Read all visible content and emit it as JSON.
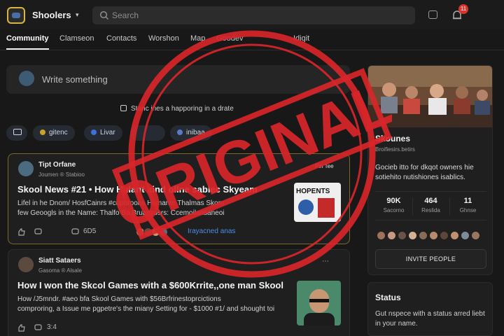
{
  "app": {
    "title": "Shoolers"
  },
  "search": {
    "placeholder": "Search"
  },
  "notifications": {
    "badge": "11"
  },
  "nav": {
    "tabs": [
      {
        "label": "Community",
        "active": true
      },
      {
        "label": "Clamseon"
      },
      {
        "label": "Contacts"
      },
      {
        "label": "Worshon"
      },
      {
        "label": "Map"
      },
      {
        "label": "Goodev"
      },
      {
        "label": "Idigit"
      }
    ]
  },
  "composer": {
    "placeholder": "Write something"
  },
  "happening": {
    "text": "Stanc ines a happoring in a drate"
  },
  "filters": [
    {
      "label": "",
      "color": ""
    },
    {
      "label": "gitenc",
      "color": "#c9a227"
    },
    {
      "label": "Livar",
      "color": "#3a72d6"
    },
    {
      "label": "",
      "color": ""
    },
    {
      "label": "inibaa",
      "color": "#5b79c9"
    }
  ],
  "posts": [
    {
      "author": "Tipt Orfane",
      "meta": "Joumen ® Stabioo",
      "pin_label": "Pin Tee",
      "title": "Skool News #21 • How Hulant kind ollne sablec Skyeam",
      "body": [
        "Lifel in he Dnom/ HosfCainrs #cupbroons Homante Thalmas Skom",
        "few Geoogls in the Name: Thalfo Ba Bruarrrosrs: Ccemoilansaneoi"
      ],
      "thumb_text": "HOPENTS",
      "likes": "",
      "comments": "6D5",
      "last_comment": "Irayacned anas"
    },
    {
      "author": "Siatt Sataers",
      "meta": "Gasoma ® Alsale",
      "title": "How I won the Skcol Games with a $600Krrite,,one man Skool",
      "body": [
        "How /J5mndr. #aeo bfa Skool Games with $56Brfrinestoprcictions",
        "comproring, a Issue me pgpetre's the miany Setting for - $1000 #1/ and shought toi"
      ],
      "comments": "3:4"
    }
  ],
  "group": {
    "name": "Skounes",
    "url": "Broifiesirs.betirs",
    "description": "Gocieb itto for dkqot owners hie sotiehito nutishiones isablics.",
    "stats": [
      {
        "value": "90K",
        "label": "Sacorno"
      },
      {
        "value": "464",
        "label": "Reslida"
      },
      {
        "value": "11",
        "label": "Ghnse"
      }
    ],
    "invite_label": "INVITE PEOPLE"
  },
  "status": {
    "title": "Status",
    "description": "Gut nspece with a status arred liebt in your name."
  },
  "overlay": {
    "stamp_text": "ORIGINAL"
  }
}
